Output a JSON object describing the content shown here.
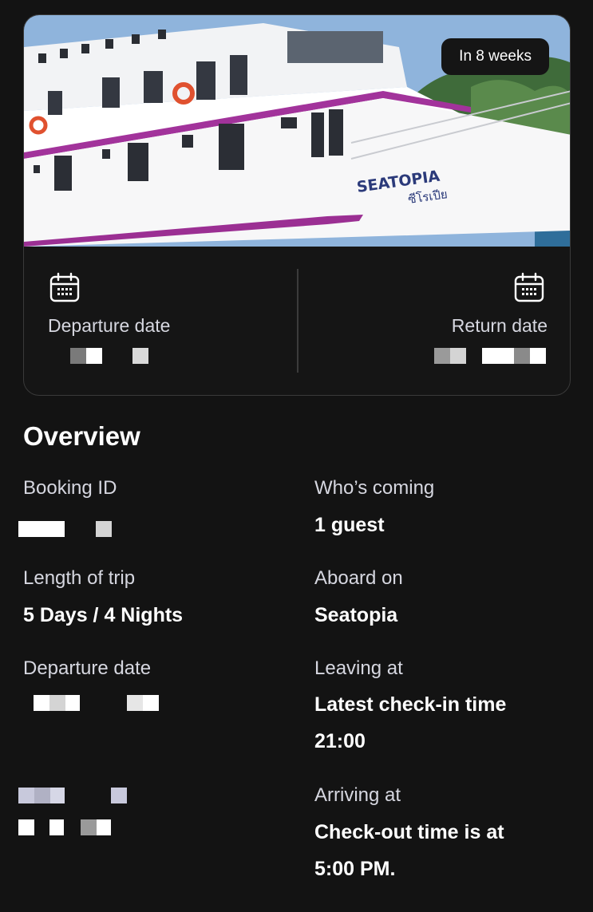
{
  "hero": {
    "badge": "In 8 weeks",
    "boat_name_painted": "SEATOPIA",
    "boat_name_thai": "ซีโรเปีย"
  },
  "dates": {
    "departure_label": "Departure date",
    "return_label": "Return date",
    "departure_icon": "calendar-icon",
    "return_icon": "calendar-icon"
  },
  "overview": {
    "title": "Overview",
    "booking_id_label": "Booking ID",
    "whos_coming_label": "Who’s coming",
    "whos_coming_value": "1 guest",
    "length_label": "Length of trip",
    "length_value": "5 Days / 4 Nights",
    "aboard_label": "Aboard on",
    "aboard_value": "Seatopia",
    "departure_label": "Departure date",
    "leaving_label": "Leaving at",
    "leaving_value_line1": "Latest check-in time",
    "leaving_value_line2": "21:00",
    "arriving_label": "Arriving at",
    "arriving_value_line1": "Check-out time is at",
    "arriving_value_line2": "5:00 PM."
  },
  "colors": {
    "background": "#131313",
    "label": "#d6d7e0",
    "value": "#ffffff",
    "border": "#3a3a3a"
  }
}
